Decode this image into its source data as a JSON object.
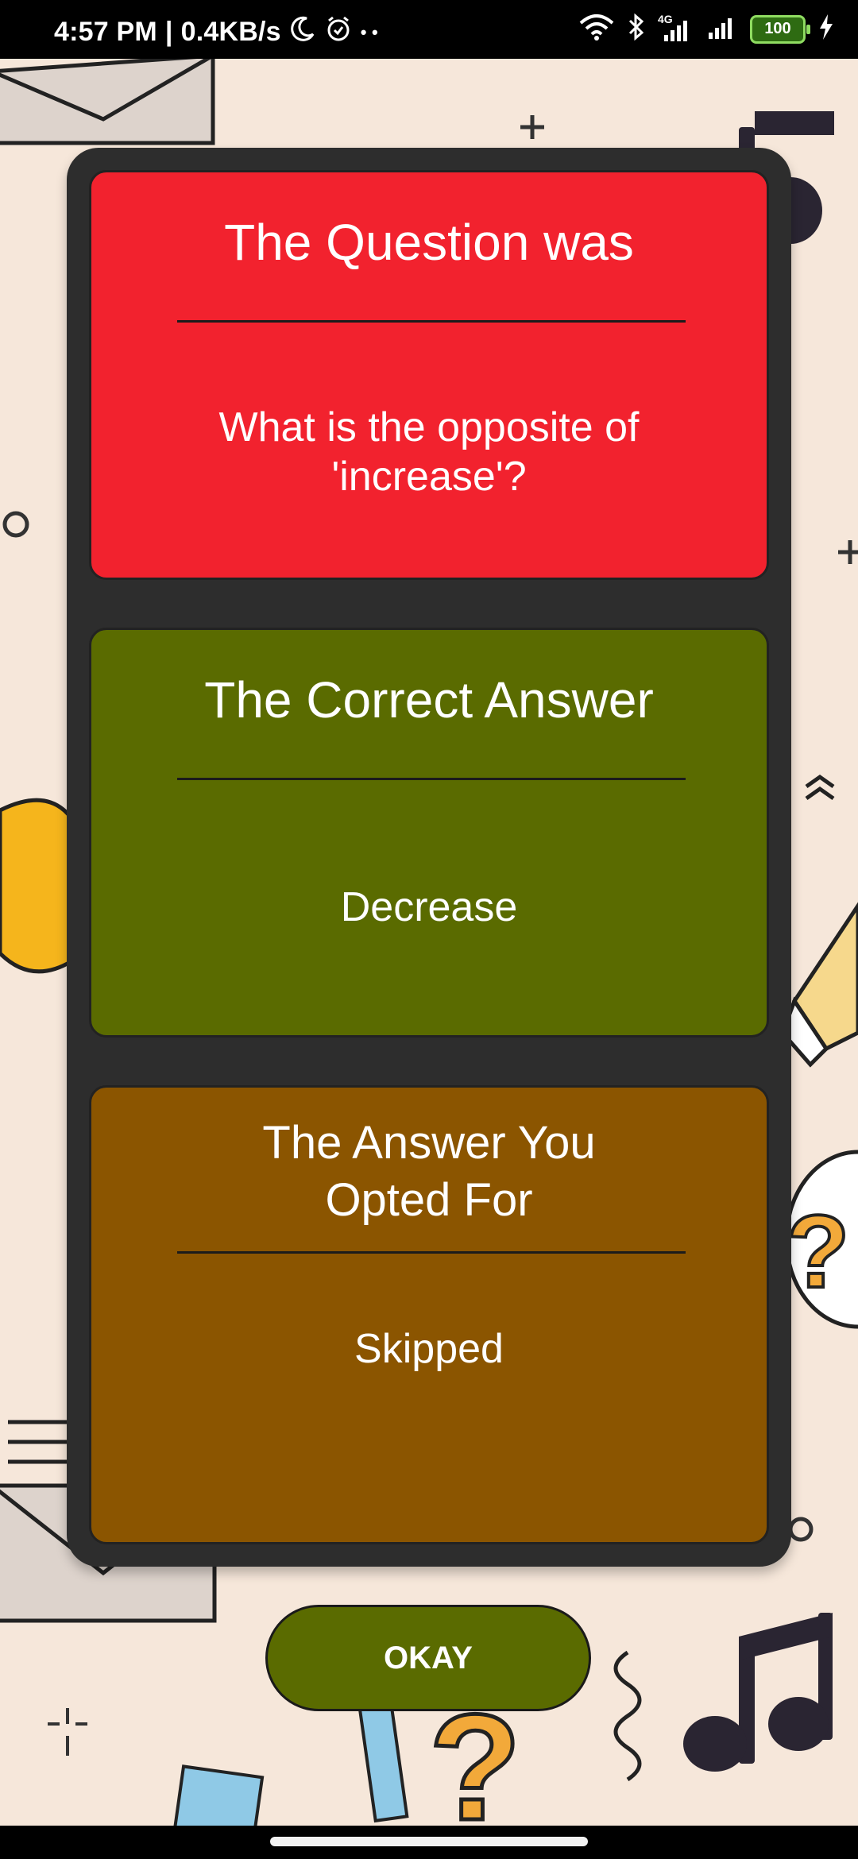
{
  "status_bar": {
    "time": "4:57 PM",
    "separator": "|",
    "speed": "0.4KB/s",
    "dots": "• •",
    "network": "4G",
    "battery": "100"
  },
  "cards": {
    "question": {
      "title": "The Question was",
      "body": "What is the opposite of 'increase'?"
    },
    "correct": {
      "title": "The Correct Answer",
      "body": "Decrease"
    },
    "user": {
      "title": "The Answer You Opted For",
      "body": "Skipped"
    }
  },
  "okay_button": {
    "label": "OKAY"
  },
  "colors": {
    "question_bg": "#f2222e",
    "correct_bg": "#5a6b00",
    "user_bg": "#8b5500",
    "dialog_bg": "#2d2d2d",
    "button_bg": "#5a6b00"
  },
  "icons": [
    "moon-icon",
    "alarm-icon",
    "wifi-icon",
    "bluetooth-icon",
    "signal-icon",
    "battery-icon",
    "charging-icon"
  ]
}
